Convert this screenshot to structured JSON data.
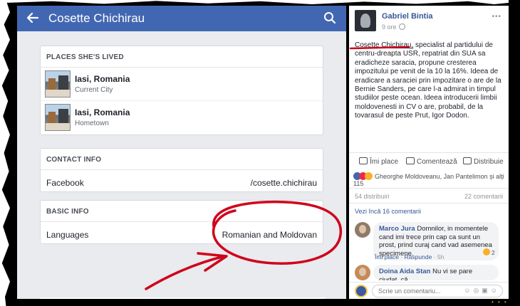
{
  "left_panel": {
    "header": {
      "title": "Cosette Chichirau",
      "back_icon": "back-arrow-icon",
      "search_icon": "search-icon"
    },
    "places": {
      "heading": "PLACES SHE'S LIVED",
      "items": [
        {
          "name": "Iasi, Romania",
          "subtitle": "Current City"
        },
        {
          "name": "Iasi, Romania",
          "subtitle": "Hometown"
        }
      ]
    },
    "contact": {
      "heading": "CONTACT INFO",
      "label": "Facebook",
      "value": "/cosette.chichirau"
    },
    "basic": {
      "heading": "BASIC INFO",
      "label": "Languages",
      "value": "Romanian and Moldovan"
    },
    "annotation_color": "#d0021b"
  },
  "post": {
    "author": "Gabriel Bintia",
    "time": "9 ore",
    "text_name": "Cosette Chichirau,",
    "text_body": " specialist al partidului de centru-dreapta USR, repatriat din SUA sa eradicheze saracia, propune cresterea impozitului pe venit de la 10 la 16%. Ideea de eradicare a saraciei prin impozitare o are de la Bernie Sanders, pe care l-a admirat in timpul studiilor peste ocean. Ideea introducerii limbii moldovenesti in CV o are, probabil, de la tovarasul de peste Prut, Igor Dodon.",
    "actions": {
      "like": "Îmi place",
      "comment": "Comentează",
      "share": "Distribuie"
    },
    "reactions_text": "Gheorghe Moldoveanu, Jan Pantelimon și alți 115",
    "shares": "54 distribuiri",
    "comments_count": "22 comentarii",
    "more_comments": "Vezi încă 16 comentarii",
    "comments": [
      {
        "author": "Marco Jura",
        "text": "Domnilor, in momentele cand imi trece prin cap ca sunt un prost, prind curaj cand vad asemenea specimene.",
        "like": "Îmi place",
        "reply": "Răspunde",
        "time": "5h",
        "reaction_count": "2"
      },
      {
        "author": "Doina Aida Stan",
        "text": "Nu vi se pare ciudat, că"
      }
    ],
    "composer_placeholder": "Scrie un comentariu..."
  }
}
